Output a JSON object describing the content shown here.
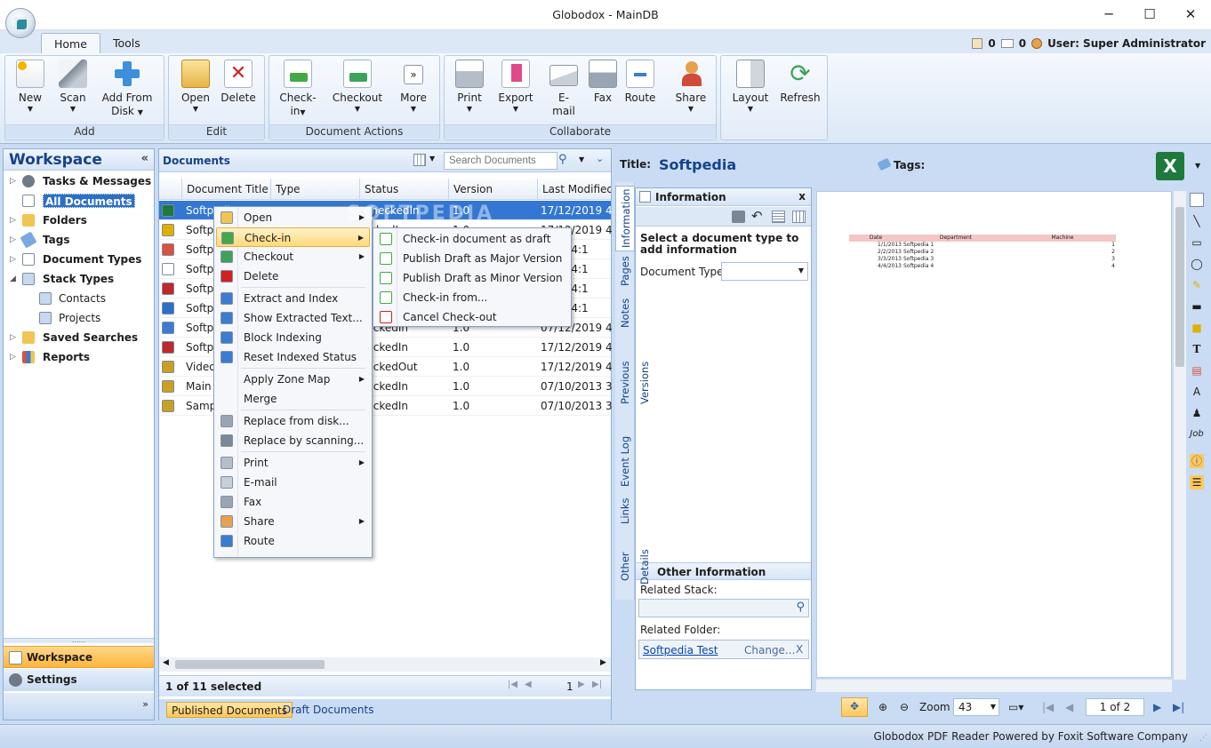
{
  "window": {
    "title": "Globodox - MainDB",
    "minimize": "─",
    "maximize": "☐",
    "close": "✕"
  },
  "ribbon_tabs": [
    {
      "label": "Home"
    },
    {
      "label": "Tools"
    }
  ],
  "status_top": {
    "tasks_count": "0",
    "mail_count": "0",
    "user": "User: Super Administrator"
  },
  "ribbon": {
    "add": {
      "label": "Add",
      "new": "New",
      "scan": "Scan",
      "add_from_disk_1": "Add From",
      "add_from_disk_2": "Disk"
    },
    "edit": {
      "label": "Edit",
      "open": "Open",
      "delete": "Delete"
    },
    "doc_actions": {
      "label": "Document Actions",
      "checkin_1": "Check-",
      "checkin_2": "in",
      "checkout": "Checkout",
      "more": "More"
    },
    "collaborate": {
      "label": "Collaborate",
      "print": "Print",
      "export": "Export",
      "email_1": "E-",
      "email_2": "mail",
      "fax": "Fax",
      "route": "Route"
    },
    "share": {
      "label": "Share"
    },
    "view": {
      "layout": "Layout",
      "refresh": "Refresh"
    }
  },
  "workspace": {
    "title": "Workspace",
    "collapse": "«",
    "tree": [
      {
        "label": "Tasks & Messages"
      },
      {
        "label": "All Documents"
      },
      {
        "label": "Folders"
      },
      {
        "label": "Tags"
      },
      {
        "label": "Document Types"
      },
      {
        "label": "Stack Types"
      },
      {
        "label": "Contacts"
      },
      {
        "label": "Projects"
      },
      {
        "label": "Saved Searches"
      },
      {
        "label": "Reports"
      }
    ],
    "nav_workspace": "Workspace",
    "nav_settings": "Settings",
    "nav_more": "»"
  },
  "documents": {
    "title": "Documents",
    "search_placeholder": "Search Documents",
    "columns": [
      "Document Title",
      "Type",
      "Status",
      "Version",
      "Last Modified On"
    ],
    "rows": [
      {
        "title": "Softpedia",
        "status": "CheckedIn",
        "version": "1.0",
        "modified": "17/12/2019 4:1"
      },
      {
        "title": "Softpe",
        "status": "eckedIn",
        "version": "1.0",
        "modified": "17/12/2019 4:1"
      },
      {
        "title": "Softpe",
        "status": "",
        "version": "",
        "modified": "2019 4:1"
      },
      {
        "title": "Softpe",
        "status": "",
        "version": "",
        "modified": "2019 4:1"
      },
      {
        "title": "Softpe",
        "status": "",
        "version": "",
        "modified": "2019 4:1"
      },
      {
        "title": "Softpe",
        "status": "",
        "version": "",
        "modified": "2019 4:1"
      },
      {
        "title": "Softpe",
        "status": "ieckedIn",
        "version": "1.0",
        "modified": "07/12/2019 4:1"
      },
      {
        "title": "Softpe",
        "status": "ieckedIn",
        "version": "1.0",
        "modified": "17/12/2019 4:1"
      },
      {
        "title": "Video",
        "status": "ieckedOut",
        "version": "1.0",
        "modified": "17/12/2019 4:0"
      },
      {
        "title": "Main D",
        "status": "ieckedIn",
        "version": "1.0",
        "modified": "07/10/2013 3:3"
      },
      {
        "title": "Sampl",
        "status": "ieckedIn",
        "version": "1.0",
        "modified": "07/10/2013 3:3"
      }
    ],
    "selection": "1 of 11 selected",
    "page": "1",
    "tab_published": "Published Documents",
    "tab_draft": "Draft Documents"
  },
  "context_menu": {
    "items": [
      "Open",
      "Check-in",
      "Checkout",
      "Delete",
      "Extract and Index",
      "Show Extracted Text...",
      "Block Indexing",
      "Reset Indexed Status",
      "Apply Zone Map",
      "Merge",
      "Replace from disk...",
      "Replace by scanning...",
      "Print",
      "E-mail",
      "Fax",
      "Share",
      "Route"
    ],
    "submenu": [
      "Check-in document as draft",
      "Publish Draft as Major Version",
      "Publish Draft as Minor Version",
      "Check-in from...",
      "Cancel Check-out"
    ]
  },
  "preview": {
    "title_label": "Title:",
    "title_value": "Softpedia",
    "tags_label": "Tags:",
    "vertical_tabs": [
      "Information",
      "Pages",
      "Notes",
      "Previous Versions",
      "Event Log",
      "Links",
      "Other Details"
    ],
    "info": {
      "header": "Information",
      "close": "x",
      "prompt": "Select a document type to add information",
      "doctype_label": "Document Type:",
      "other_header": "Other Information",
      "related_stack": "Related Stack:",
      "related_folder": "Related Folder:",
      "folder_value": "Softpedia Test",
      "change": "Change...",
      "remove": "X"
    },
    "sheet": {
      "headers": [
        "Date",
        "Department",
        "Machine"
      ],
      "rows": [
        [
          "1/1/2013",
          "Softpedia 1",
          "1"
        ],
        [
          "2/2/2013",
          "Softpedia 2",
          "2"
        ],
        [
          "3/3/2013",
          "Softpedia 3",
          "3"
        ],
        [
          "4/4/2013",
          "Softpedia 4",
          "4"
        ]
      ]
    },
    "zoom_label": "Zoom",
    "zoom_value": "43",
    "page_value": "1 of 2"
  },
  "statusbar": "Globodox PDF Reader Powered by Foxit Software Company",
  "watermark": "SOFTPEDIA",
  "colors": {
    "accent": "#15428b",
    "selection": "#3377d2",
    "highlight": "#ffd97a"
  }
}
